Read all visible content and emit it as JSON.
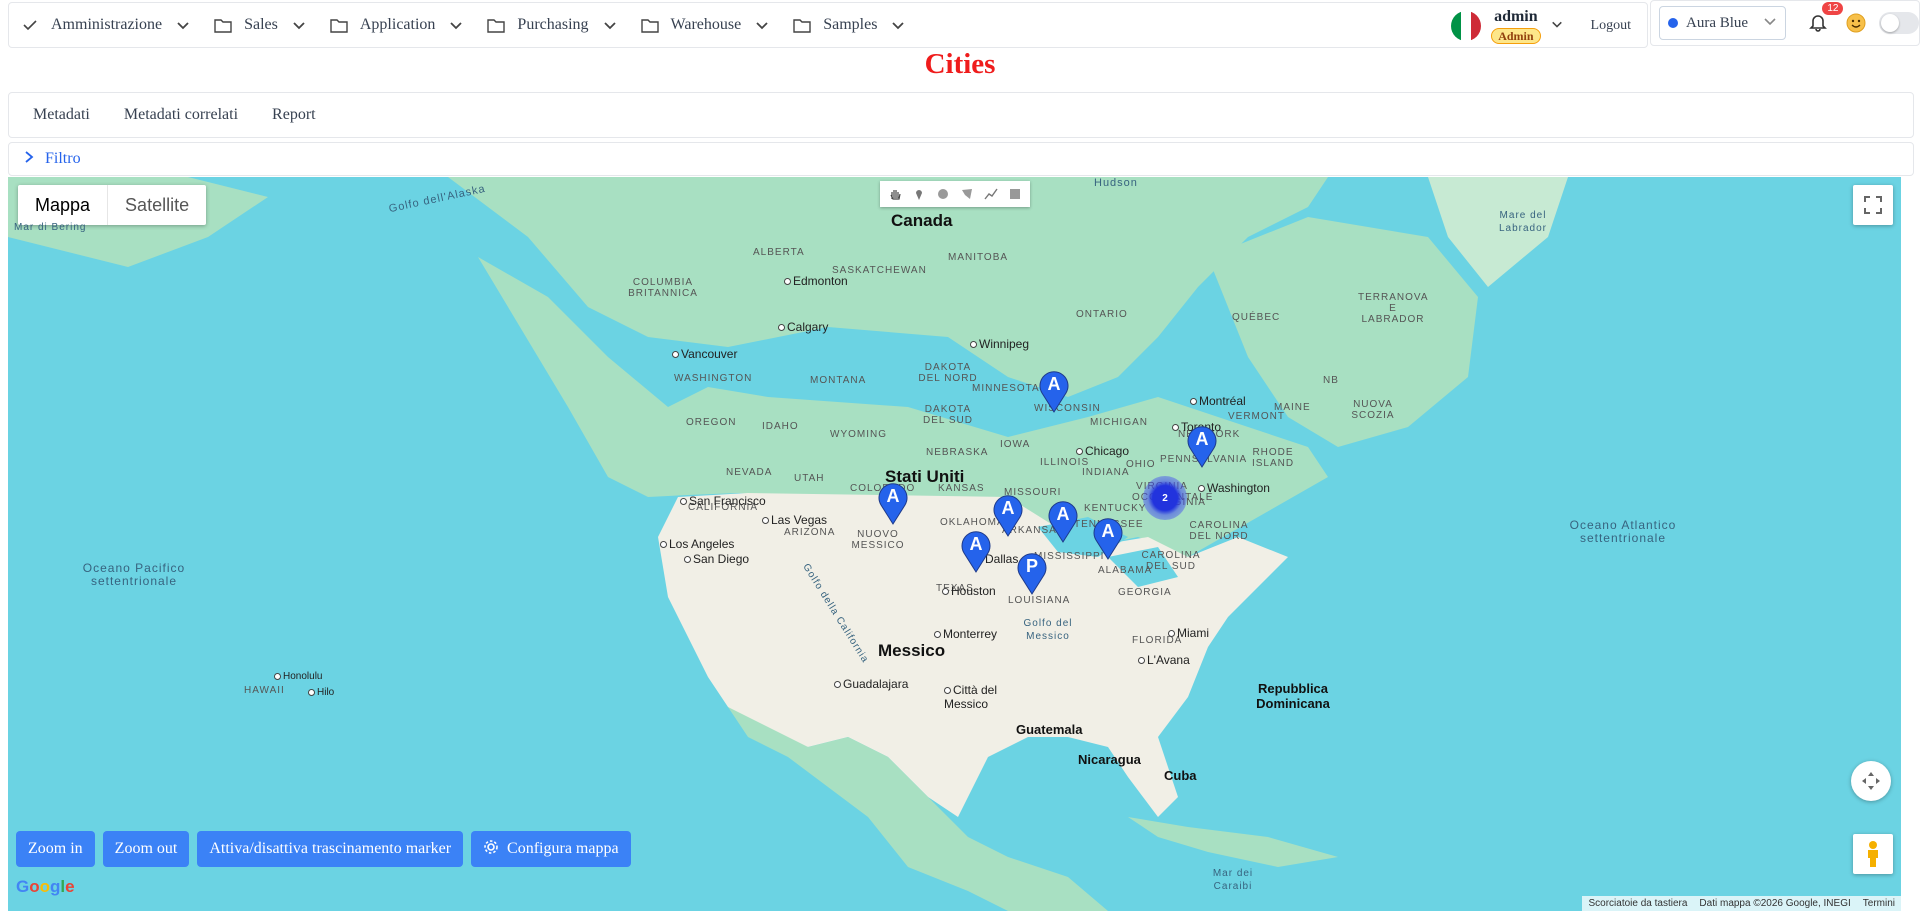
{
  "nav": {
    "items": [
      {
        "label": "Amministrazione",
        "icon": "check-icon"
      },
      {
        "label": "Sales",
        "icon": "folder-icon"
      },
      {
        "label": "Application",
        "icon": "folder-icon"
      },
      {
        "label": "Purchasing",
        "icon": "folder-icon"
      },
      {
        "label": "Warehouse",
        "icon": "folder-icon"
      },
      {
        "label": "Samples",
        "icon": "folder-icon"
      }
    ],
    "user": {
      "name": "admin",
      "role": "Admin",
      "language_flag": "italy-flag-icon"
    },
    "logout_label": "Logout",
    "theme": "Aura Blue",
    "notifications": "12"
  },
  "page_title": "Cities",
  "tabs": [
    "Metadati",
    "Metadati correlati",
    "Report"
  ],
  "filter_label": "Filtro",
  "map": {
    "type_buttons": {
      "map": "Mappa",
      "satellite": "Satellite"
    },
    "labels": {
      "countries": [
        "Canada",
        "Stati Uniti",
        "Messico",
        "Cuba",
        "Repubblica Dominicana",
        "Guatemala",
        "Nicaragua"
      ],
      "oceans": [
        "Oceano Pacifico settentrionale",
        "Oceano Atlantico settentrionale",
        "Golfo dell'Alaska",
        "Mar di Bering",
        "Mare del Labrador",
        "Hudson",
        "Golfo del Messico",
        "Golfo della California",
        "Mar dei Caraibi"
      ],
      "states": [
        "ALBERTA",
        "SASKATCHEWAN",
        "MANITOBA",
        "COLUMBIA BRITANNICA",
        "ONTARIO",
        "QUÉBEC",
        "TERRANOVA E LABRADOR",
        "NB",
        "NUOVA SCOZIA",
        "WASHINGTON",
        "MONTANA",
        "DAKOTA DEL NORD",
        "DAKOTA DEL SUD",
        "MINNESOTA",
        "WISCONSIN",
        "MICHIGAN",
        "OREGON",
        "IDAHO",
        "WYOMING",
        "NEBRASKA",
        "IOWA",
        "ILLINOIS",
        "INDIANA",
        "OHIO",
        "PENNSYLVANIA",
        "NEW YORK",
        "VERMONT",
        "MAINE",
        "NEVADA",
        "UTAH",
        "COLORADO",
        "KANSAS",
        "MISSOURI",
        "KENTUCKY",
        "VIRGINIA OCCIDENTALE",
        "VIRGINIA",
        "CALIFORNIA",
        "ARIZONA",
        "NUOVO MESSICO",
        "OKLAHOMA",
        "ARKANSAS",
        "TENNESSEE",
        "CAROLINA DEL NORD",
        "CAROLINA DEL SUD",
        "MISSISSIPPI",
        "ALABAMA",
        "GEORGIA",
        "TEXAS",
        "LOUISIANA",
        "FLORIDA",
        "HAWAII",
        "RHODE ISLAND"
      ],
      "cities": [
        "Edmonton",
        "Calgary",
        "Vancouver",
        "Winnipeg",
        "Montréal",
        "Toronto",
        "Chicago",
        "Washington",
        "San Francisco",
        "Las Vegas",
        "Los Angeles",
        "San Diego",
        "Dallas",
        "Houston",
        "Monterrey",
        "Miami",
        "L'Avana",
        "Guadalajara",
        "Città del Messico",
        "Honolulu",
        "Hilo"
      ]
    },
    "markers": [
      "A",
      "A",
      "A",
      "A",
      "A",
      "A",
      "A",
      "P"
    ],
    "cluster_count": "2",
    "buttons": {
      "zoom_in": "Zoom in",
      "zoom_out": "Zoom out",
      "toggle_drag": "Attiva/disattiva trascinamento marker",
      "configure": "Configura mappa"
    },
    "google_logo": "Google",
    "attribution": [
      "Scorciatoie da tastiera",
      "Dati mappa ©2026 Google, INEGI",
      "Termini"
    ],
    "colors": {
      "water": "#6bd3e3",
      "land": "#a8e0c2",
      "land_us": "#f1efe6",
      "marker": "#2563eb",
      "button": "#3b82f6",
      "title": "#ef1c1c"
    }
  }
}
